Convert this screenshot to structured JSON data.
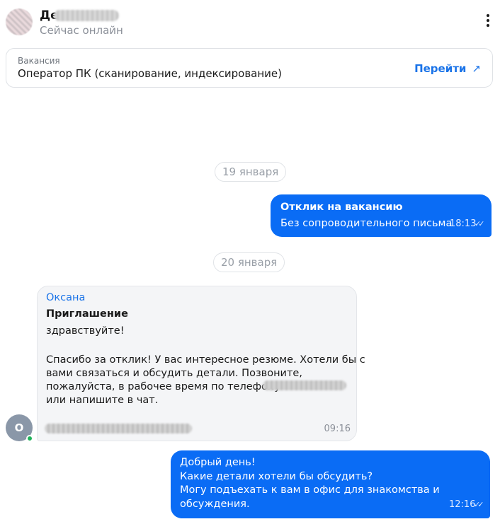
{
  "header": {
    "contact_name": "Де",
    "status": "Сейчас онлайн",
    "more_icon": "more-vertical-icon"
  },
  "vacancy": {
    "label": "Вакансия",
    "title": "Оператор ПК (сканирование, индексирование)",
    "go_label": "Перейти",
    "go_arrow": "↗"
  },
  "dates": [
    "19 января",
    "20 января"
  ],
  "messages": {
    "out1": {
      "title": "Отклик на вакансию",
      "text": "Без сопроводительного письма",
      "time": "18:13",
      "ticks": "✓✓"
    },
    "in1": {
      "sender": "Оксана",
      "title": "Приглашение",
      "lines": [
        "здравствуйте!",
        "Спасибо за отклик! У вас интересное резюме. Хотели бы с",
        "вами связаться и обсудить детали. Позвоните,",
        "пожалуйста, в рабочее время по телефону",
        "или напишите в чат."
      ],
      "time": "09:16",
      "avatar_letter": "О"
    },
    "out2": {
      "lines": [
        "Добрый день!",
        "Какие детали хотели бы обсудить?",
        "Могу подъехать к вам в офис для знакомства и",
        "обсуждения."
      ],
      "time": "12:16",
      "ticks": "✓✓"
    }
  },
  "colors": {
    "accent": "#1a73e8",
    "bubble_out": "#0a6cf5",
    "bubble_in": "#f4f5f7",
    "online": "#1fb35a"
  }
}
